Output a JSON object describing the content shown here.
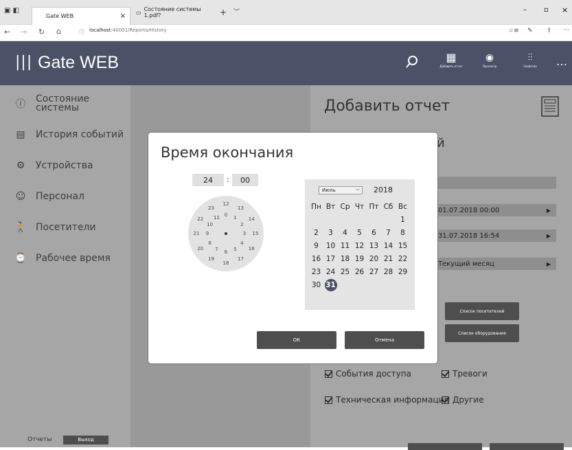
{
  "browser": {
    "tabs": [
      {
        "label": "Gate WEB"
      },
      {
        "label": "Состояние системы 1.pdf?"
      }
    ],
    "url_prefix": "localhost",
    "url_rest": ":40001/Reports/History"
  },
  "app": {
    "title": "Gate WEB",
    "toolbar": [
      {
        "label": "Добавить отчет",
        "icon": "add-report-icon"
      },
      {
        "label": "Просмотр",
        "icon": "eye-icon"
      },
      {
        "label": "Свойства",
        "icon": "properties-icon"
      }
    ]
  },
  "sidebar": {
    "items": [
      {
        "label": "Состояние системы",
        "icon": "info-icon"
      },
      {
        "label": "История событий",
        "icon": "history-icon"
      },
      {
        "label": "Устройства",
        "icon": "gear-icon"
      },
      {
        "label": "Персонал",
        "icon": "staff-icon"
      },
      {
        "label": "Посетители",
        "icon": "visitor-icon"
      },
      {
        "label": "Рабочее время",
        "icon": "worktime-icon"
      }
    ],
    "footer_label": "Отчеты",
    "logout_label": "Выход"
  },
  "report": {
    "title": "Добавить отчет",
    "partial_text": "й",
    "from_date": "01.07.2018 00:00",
    "to_date": "31.07.2018 16:54",
    "period": "Текущий месяц",
    "visitors_button": "Список посетителей",
    "equipment_button": "Список оборудования",
    "checkboxes": [
      {
        "label": "События доступа",
        "checked": true
      },
      {
        "label": "Тревоги",
        "checked": true
      },
      {
        "label": "Техническая информация",
        "checked": true
      },
      {
        "label": "Другие",
        "checked": true
      }
    ]
  },
  "dialog": {
    "title": "Время окончания",
    "hours": "24",
    "separator": ":",
    "minutes": "00",
    "clock_inner": [
      "0",
      "1",
      "2",
      "3",
      "4",
      "5",
      "6",
      "7",
      "8",
      "9",
      "10",
      "11"
    ],
    "clock_outer": [
      "12",
      "13",
      "14",
      "15",
      "16",
      "17",
      "18",
      "19",
      "20",
      "21",
      "22",
      "23"
    ],
    "month": "Июль",
    "year": "2018",
    "weekdays": [
      "Пн",
      "Вт",
      "Ср",
      "Чт",
      "Пт",
      "Сб",
      "Вс"
    ],
    "days": [
      "",
      "",
      "",
      "",
      "",
      "",
      "1",
      "2",
      "3",
      "4",
      "5",
      "6",
      "7",
      "8",
      "9",
      "10",
      "11",
      "12",
      "13",
      "14",
      "15",
      "16",
      "17",
      "18",
      "19",
      "20",
      "21",
      "22",
      "23",
      "24",
      "25",
      "26",
      "27",
      "28",
      "29",
      "30",
      "31"
    ],
    "selected_day": "31",
    "ok_label": "ОК",
    "cancel_label": "Отмена"
  },
  "colors": {
    "header": "#4b5166",
    "sidebar": "#a6a6a6",
    "button": "#4e4e4e"
  }
}
